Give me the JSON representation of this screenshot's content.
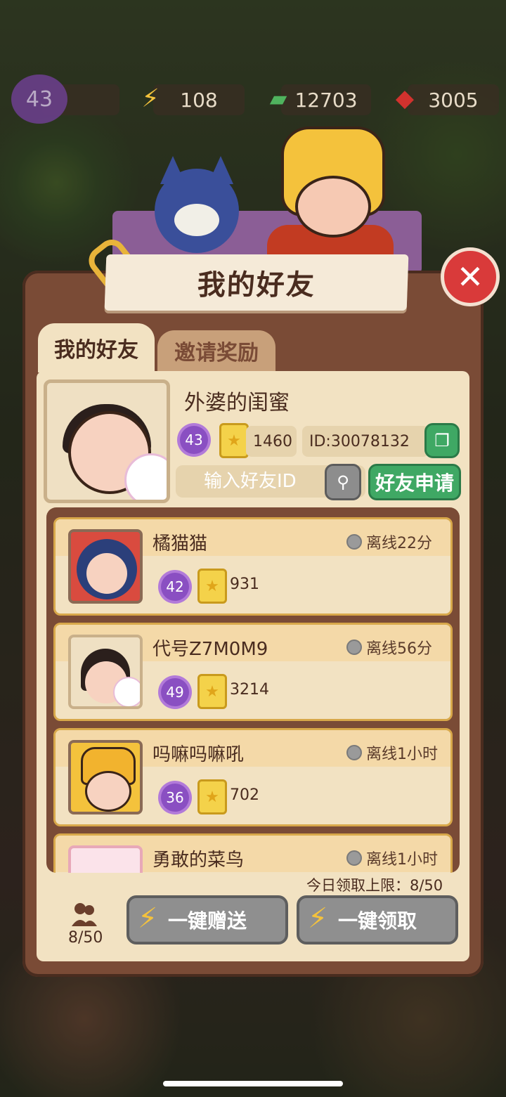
{
  "resources": {
    "level": "43",
    "energy": "108",
    "cash": "12703",
    "gems": "3005"
  },
  "panel": {
    "title": "我的好友"
  },
  "tabs": [
    {
      "label": "我的好友"
    },
    {
      "label": "邀请奖励"
    }
  ],
  "me": {
    "name": "外婆的闺蜜",
    "level": "43",
    "score": "1460",
    "id": "ID:30078132"
  },
  "search": {
    "placeholder": "输入好友ID",
    "apply_label": "好友申请"
  },
  "friends": [
    {
      "name": "橘猫猫",
      "status": "离线22分",
      "level": "42",
      "score": "931"
    },
    {
      "name": "代号Z7M0M9",
      "status": "离线56分",
      "level": "49",
      "score": "3214"
    },
    {
      "name": "吗嘛吗嘛吼",
      "status": "离线1小时",
      "level": "36",
      "score": "702"
    },
    {
      "name": "勇敢的菜鸟",
      "status": "离线1小时"
    }
  ],
  "footer": {
    "limit": "今日领取上限：8/50",
    "friends_count": "8/50",
    "send_all": "一键赠送",
    "claim_all": "一键领取"
  }
}
